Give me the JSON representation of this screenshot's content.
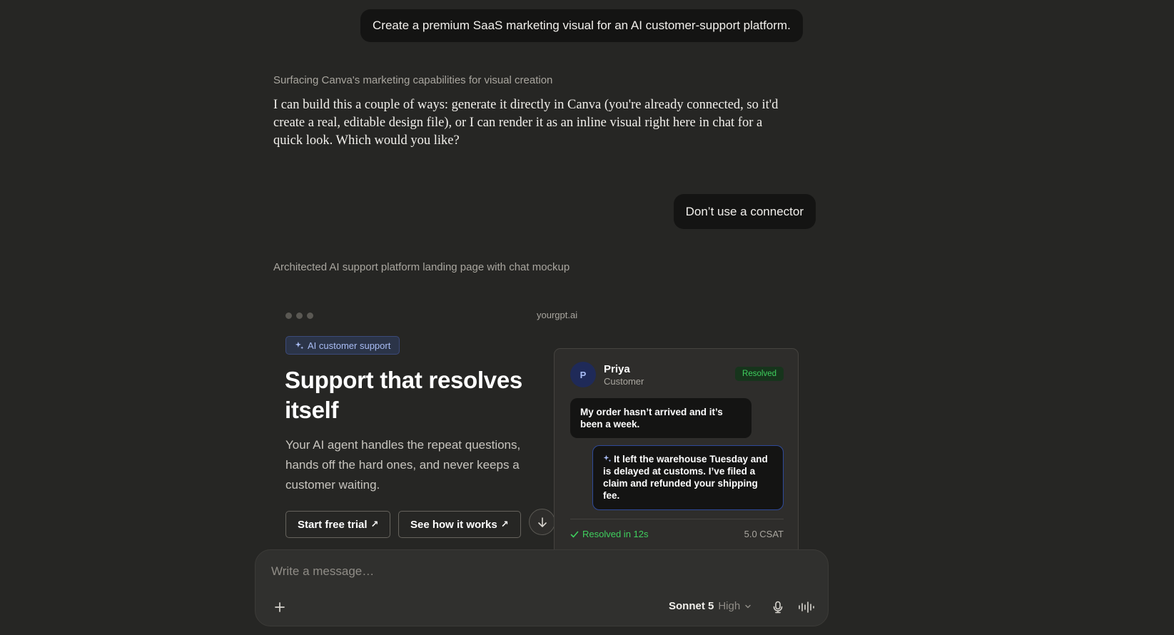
{
  "conversation": {
    "user_message_1": "Create a premium SaaS marketing visual for an AI customer-support platform.",
    "thinking_1": "Surfacing Canva's marketing capabilities for visual creation",
    "assistant_answer_1": "I can build this a couple of ways: generate it directly in Canva (you're already connected, so it'd create a real, editable design file), or I can render it as an inline visual right here in chat for a quick look. Which would you like?",
    "user_message_2": "Don’t use a connector",
    "thinking_2": "Architected AI support platform landing page with chat mockup"
  },
  "preview": {
    "url": "yourgpt.ai",
    "badge": "AI customer support",
    "headline": "Support that resolves itself",
    "subheadline": "Your AI agent handles the repeat questions, hands off the hard ones, and never keeps a customer waiting.",
    "primary_cta": "Start free trial",
    "secondary_cta": "See how it works",
    "arrow_glyph": "↗",
    "chat_card": {
      "avatar_initial": "P",
      "customer_name": "Priya",
      "customer_role": "Customer",
      "status": "Resolved",
      "customer_message": "My order hasn’t arrived and it’s been a week.",
      "ai_reply": "It left the warehouse Tuesday and is delayed at customs. I’ve filed a claim and refunded your shipping fee.",
      "resolved_time": "Resolved in 12s",
      "csat": "5.0 CSAT"
    },
    "colors": {
      "accent_blue": "#a9bdf5",
      "success_green": "#3fcf5e"
    }
  },
  "composer": {
    "placeholder": "Write a message…",
    "model": "Sonnet 5",
    "effort": "High"
  }
}
